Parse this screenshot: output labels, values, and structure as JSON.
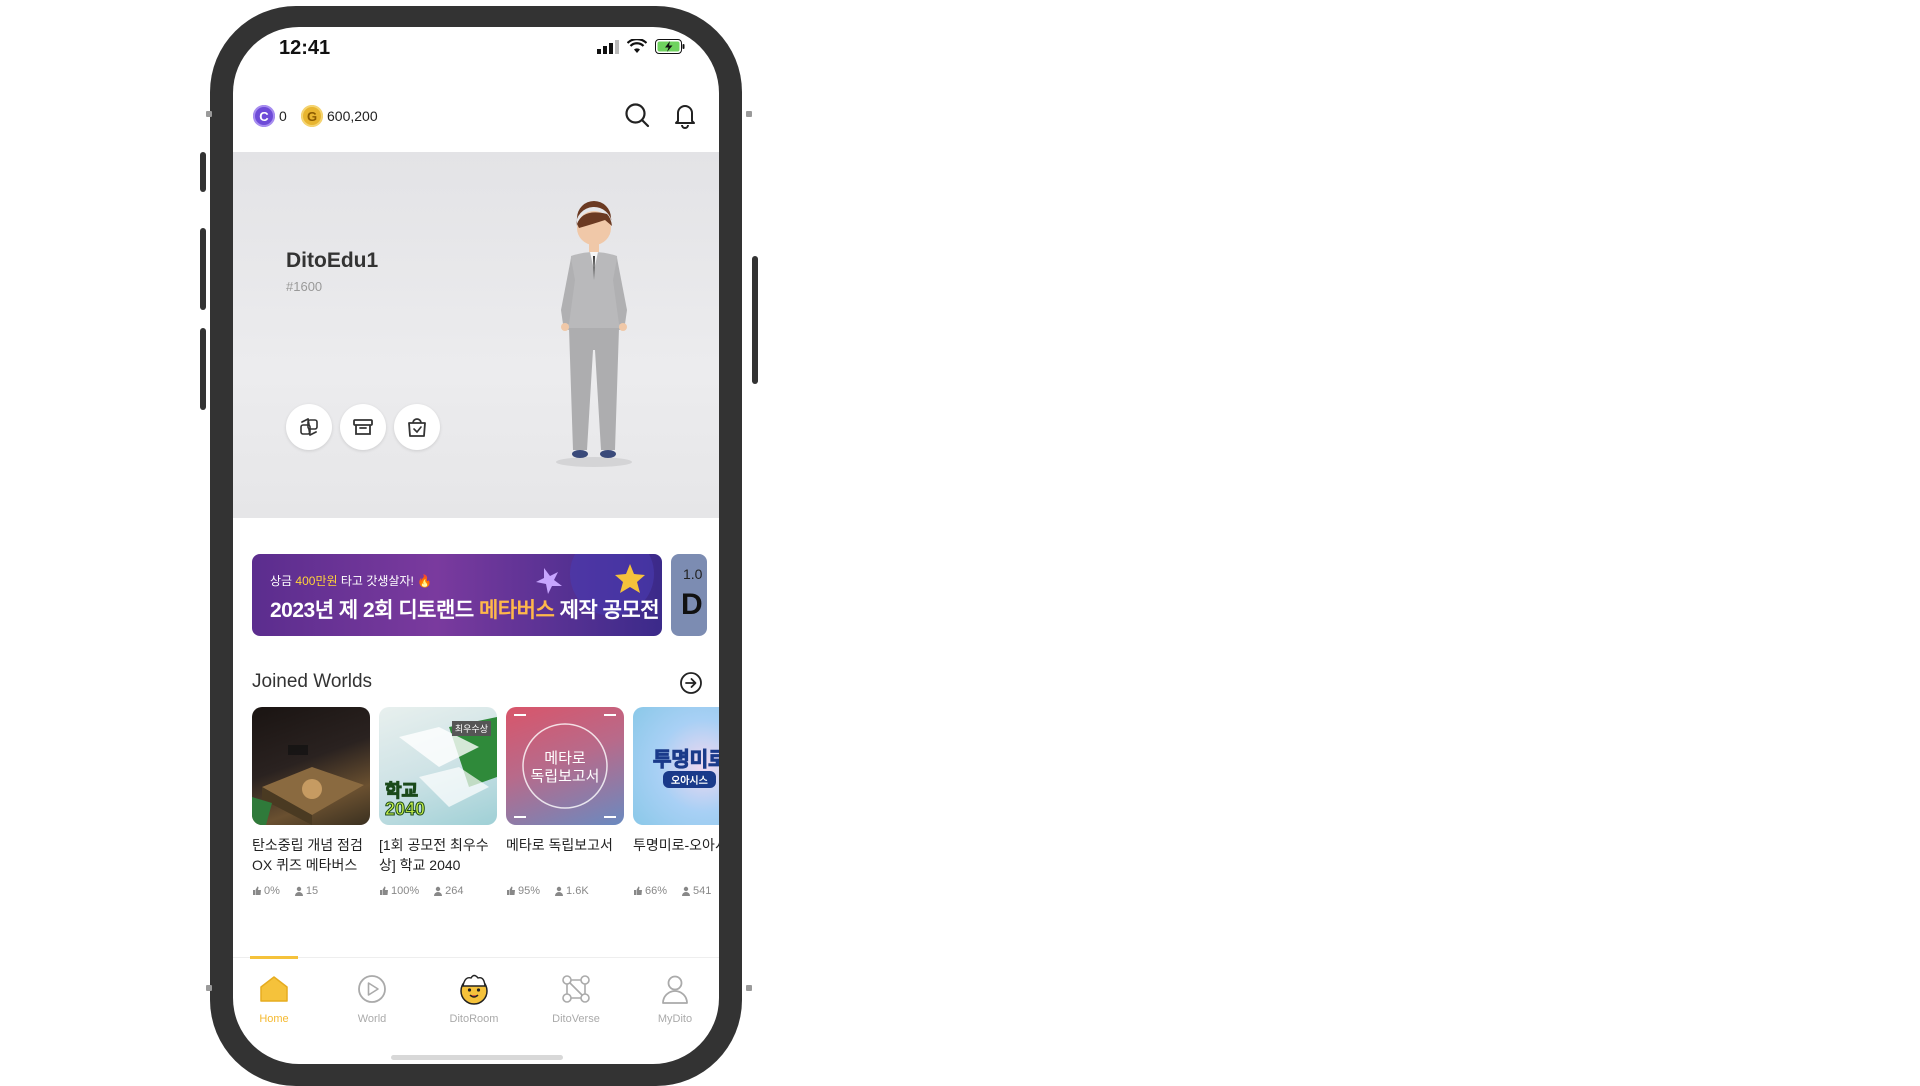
{
  "status_bar": {
    "time": "12:41"
  },
  "currency": {
    "crystal_symbol": "C",
    "crystal_amount": "0",
    "gold_symbol": "G",
    "gold_amount": "600,200"
  },
  "profile": {
    "name": "DitoEdu1",
    "tag": "#1600"
  },
  "banner": {
    "subtitle_pre": "상금 ",
    "subtitle_highlight": "400만원",
    "subtitle_post": " 타고 갓생살자! 🔥",
    "title_pre": "2023년 제 2회 디토랜드 ",
    "title_highlight": "메타버스",
    "title_post": " 제작 공모전",
    "next_peek_top": "1.0",
    "next_peek_big": "D"
  },
  "joined_worlds": {
    "title": "Joined Worlds",
    "items": [
      {
        "title": "탄소중립 개념 점검 OX 퀴즈 메타버스",
        "likes": "0%",
        "players": "15"
      },
      {
        "title": "[1회 공모전 최우수상] 학교 2040",
        "likes": "100%",
        "players": "264",
        "thumb_badge": "최우수상",
        "thumb_text": "학교",
        "thumb_text2": "2040"
      },
      {
        "title": "메타로 독립보고서",
        "likes": "95%",
        "players": "1.6K",
        "thumb_text": "메타로",
        "thumb_text2": "독립보고서"
      },
      {
        "title": "투명미로-오아시스",
        "likes": "66%",
        "players": "541",
        "thumb_text": "투명미로",
        "thumb_text2": "오아시스"
      }
    ]
  },
  "bottom_nav": {
    "items": [
      {
        "label": "Home",
        "active": true
      },
      {
        "label": "World",
        "active": false
      },
      {
        "label": "DitoRoom",
        "active": false
      },
      {
        "label": "DitoVerse",
        "active": false
      },
      {
        "label": "MyDito",
        "active": false
      }
    ]
  },
  "colors": {
    "accent": "#f5c23b",
    "frame": "#333333",
    "hero_bg": "#e8e8ea",
    "banner_bg": "#5b2d8e"
  }
}
